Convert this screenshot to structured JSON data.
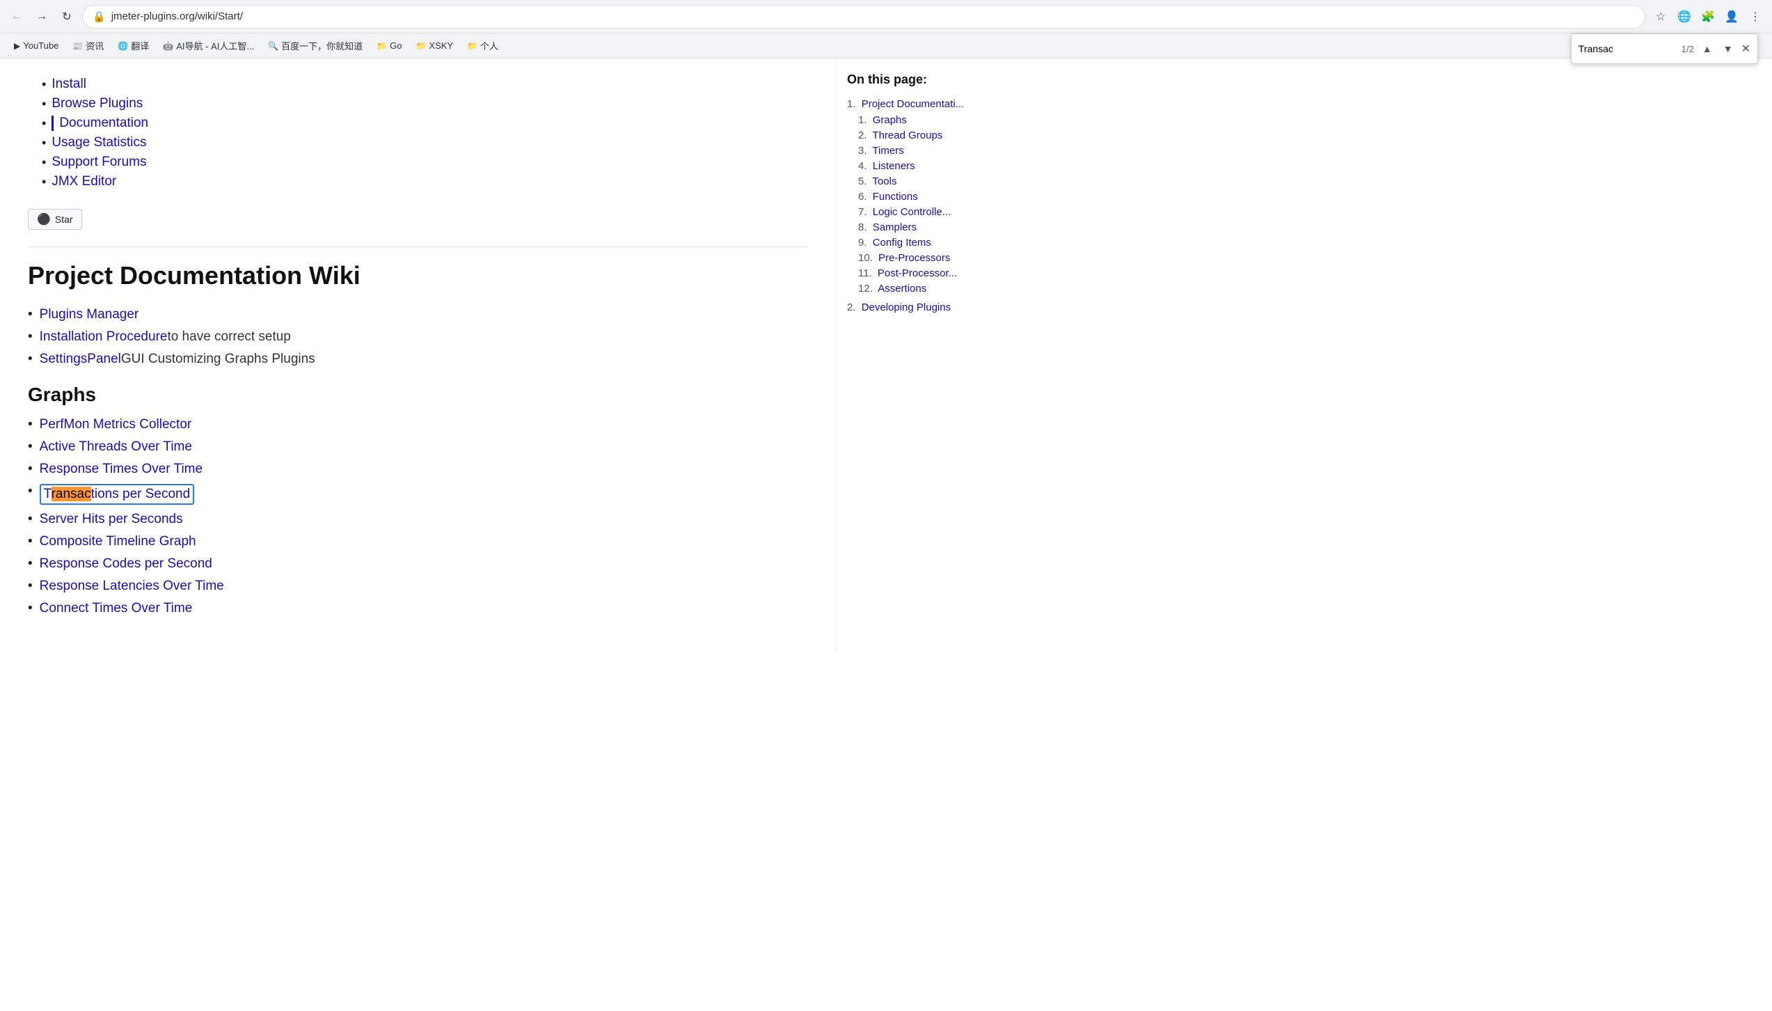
{
  "browser": {
    "back_button": "←",
    "forward_button": "→",
    "reload_button": "↻",
    "url": "jmeter-plugins.org/wiki/Start/",
    "find_query": "Transac",
    "find_count": "1/2",
    "find_prev": "▲",
    "find_next": "▼",
    "find_close": "✕"
  },
  "bookmarks": [
    {
      "label": "YouTube",
      "icon": "▶"
    },
    {
      "label": "资讯",
      "icon": "📰"
    },
    {
      "label": "翻译",
      "icon": "🌐"
    },
    {
      "label": "AI导航 - AI人工智...",
      "icon": "🤖"
    },
    {
      "label": "百度一下，你就知道",
      "icon": "🔍"
    },
    {
      "label": "Go",
      "icon": "📁"
    },
    {
      "label": "XSKY",
      "icon": "📁"
    },
    {
      "label": "个人",
      "icon": "📁"
    }
  ],
  "nav_items": [
    {
      "label": "Install",
      "href": "#",
      "active": false
    },
    {
      "label": "Browse Plugins",
      "href": "#",
      "active": false
    },
    {
      "label": "Documentation",
      "href": "#",
      "active": true
    },
    {
      "label": "Usage Statistics",
      "href": "#",
      "active": false
    },
    {
      "label": "Support Forums",
      "href": "#",
      "active": false
    },
    {
      "label": "JMX Editor",
      "href": "#",
      "active": false
    }
  ],
  "github_star_label": "Star",
  "page_title": "Project Documentation Wiki",
  "intro_items": [
    {
      "link": "Plugins Manager",
      "text": null
    },
    {
      "link": "Installation Procedure",
      "text": " to have correct setup"
    },
    {
      "link": "SettingsPanel",
      "text": " GUI Customizing Graphs Plugins"
    }
  ],
  "graphs_heading": "Graphs",
  "graphs_items": [
    {
      "link": "PerfMon Metrics Collector",
      "highlighted": false,
      "highlight_start": -1,
      "highlight_end": -1
    },
    {
      "link": "Active Threads Over Time",
      "highlighted": false
    },
    {
      "link": "Response Times Over Time",
      "highlighted": false
    },
    {
      "link": "Transactions per Second",
      "highlighted": true,
      "highlight_pre": "T",
      "highlight_mid": "ransac",
      "highlight_post": "tions per Second",
      "boxed": true
    },
    {
      "link": "Server Hits per Seconds",
      "highlighted": false
    },
    {
      "link": "Composite Timeline Graph",
      "highlighted": false
    },
    {
      "link": "Response Codes per Second",
      "highlighted": false
    },
    {
      "link": "Response Latencies Over Time",
      "highlighted": false
    },
    {
      "link": "Connect Times Over Time",
      "highlighted": false
    }
  ],
  "sidebar": {
    "title": "On this page:",
    "toc": [
      {
        "num": "1.",
        "label": "Project Documentati...",
        "sub": [
          {
            "num": "1.",
            "label": "Graphs"
          },
          {
            "num": "2.",
            "label": "Thread Groups"
          },
          {
            "num": "3.",
            "label": "Timers"
          },
          {
            "num": "4.",
            "label": "Listeners"
          },
          {
            "num": "5.",
            "label": "Tools"
          },
          {
            "num": "6.",
            "label": "Functions"
          },
          {
            "num": "7.",
            "label": "Logic Controlle..."
          },
          {
            "num": "8.",
            "label": "Samplers"
          },
          {
            "num": "9.",
            "label": "Config Items"
          },
          {
            "num": "10.",
            "label": "Pre-Processors"
          },
          {
            "num": "11.",
            "label": "Post-Processor..."
          },
          {
            "num": "12.",
            "label": "Assertions"
          }
        ]
      },
      {
        "num": "2.",
        "label": "Developing Plugins",
        "sub": []
      }
    ]
  }
}
